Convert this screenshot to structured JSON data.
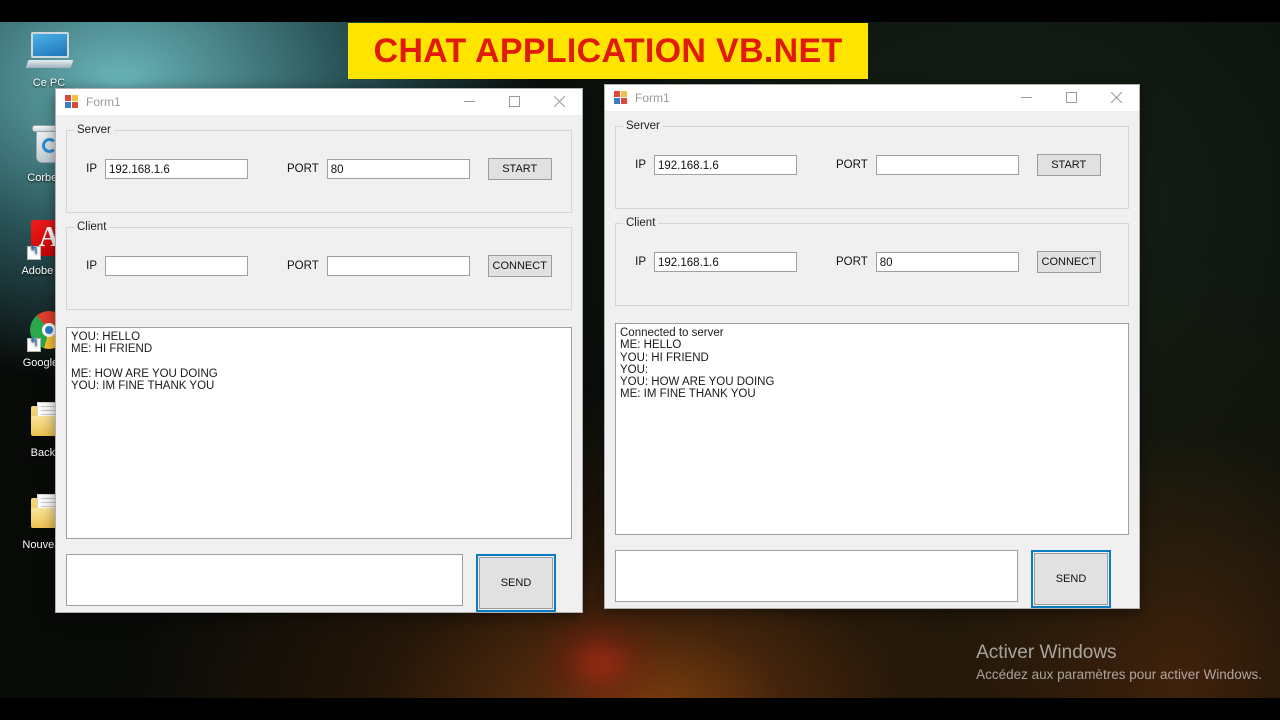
{
  "banner": {
    "text": "CHAT APPLICATION VB.NET"
  },
  "desktop": {
    "icons": [
      {
        "label": "Ce PC",
        "icon": "monitor-icon",
        "shortcut": false
      },
      {
        "label": "Corbeille",
        "icon": "recycle-bin-icon",
        "shortcut": false
      },
      {
        "label": "Adobe Rea",
        "icon": "adobe-reader-icon",
        "shortcut": true
      },
      {
        "label": "Google Ch",
        "icon": "google-chrome-icon",
        "shortcut": true
      },
      {
        "label": "Backup",
        "icon": "folder-icon",
        "shortcut": false
      },
      {
        "label": "Nouveau d",
        "icon": "folder-icon",
        "shortcut": false
      }
    ],
    "watermark": {
      "title": "Activer Windows",
      "subtitle": "Accédez aux paramètres pour activer Windows."
    }
  },
  "windows": [
    {
      "id": "server-window",
      "title": "Form1",
      "controls": {
        "minimize": "–",
        "maximize": "□",
        "close": "✕"
      },
      "server": {
        "legend": "Server",
        "ip_label": "IP",
        "ip_value": "192.168.1.6",
        "port_label": "PORT",
        "port_value": "80",
        "action_label": "START"
      },
      "client": {
        "legend": "Client",
        "ip_label": "IP",
        "ip_value": "",
        "port_label": "PORT",
        "port_value": "",
        "action_label": "CONNECT"
      },
      "chat_log": "YOU: HELLO\nME: HI FRIEND\n\nME: HOW ARE YOU DOING\nYOU: IM FINE THANK YOU",
      "message_value": "",
      "send_label": "SEND"
    },
    {
      "id": "client-window",
      "title": "Form1",
      "controls": {
        "minimize": "–",
        "maximize": "□",
        "close": "✕"
      },
      "server": {
        "legend": "Server",
        "ip_label": "IP",
        "ip_value": "192.168.1.6",
        "port_label": "PORT",
        "port_value": "",
        "action_label": "START"
      },
      "client": {
        "legend": "Client",
        "ip_label": "IP",
        "ip_value": "192.168.1.6",
        "port_label": "PORT",
        "port_value": "80",
        "action_label": "CONNECT"
      },
      "chat_log": "Connected to server\nME: HELLO\nYOU: HI FRIEND\nYOU:\nYOU: HOW ARE YOU DOING\nME: IM FINE THANK YOU",
      "message_value": "",
      "send_label": "SEND"
    }
  ],
  "colors": {
    "banner_bg": "#ffe400",
    "banner_fg": "#e11b0c",
    "form_bg": "#f0f0f0",
    "focus_border": "#0a7cc4",
    "button_face": "#e1e1e1"
  }
}
